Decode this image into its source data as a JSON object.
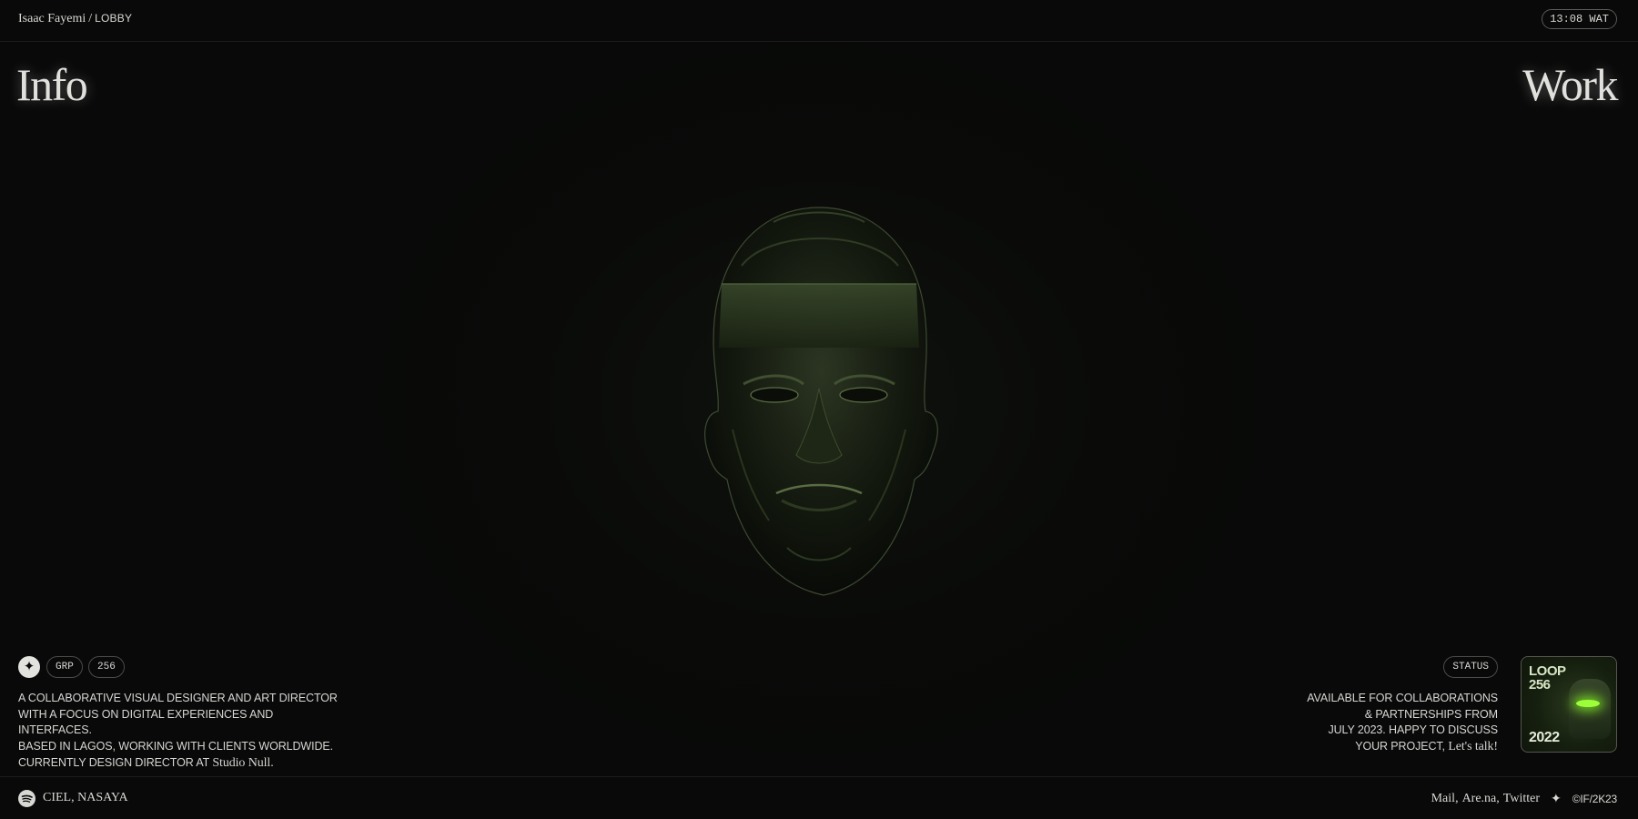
{
  "header": {
    "name": "Isaac Fayemi",
    "separator": "/",
    "section": "LOBBY",
    "clock": "13:08 WAT"
  },
  "nav": {
    "left": "Info",
    "right": "Work"
  },
  "hero": {
    "icon": "sculpted-head-artwork",
    "tint": "#2f3a24"
  },
  "left_panel": {
    "badge_icon": "sparkle-icon",
    "pills": [
      "GRP",
      "256"
    ],
    "bio_lines": [
      "A COLLABORATIVE VISUAL DESIGNER AND ART DIRECTOR",
      "WITH A FOCUS ON DIGITAL EXPERIENCES AND INTERFACES.",
      "BASED IN LAGOS, WORKING WITH CLIENTS WORLDWIDE.",
      "CURRENTLY DESIGN DIRECTOR AT"
    ],
    "studio": "Studio Null."
  },
  "right_panel": {
    "status_label": "STATUS",
    "status_lines": [
      "AVAILABLE FOR COLLABORATIONS",
      "& PARTNERSHIPS FROM",
      "JULY 2023. HAPPY TO DISCUSS",
      "YOUR PROJECT,"
    ],
    "cta": "Let's talk!",
    "card": {
      "title_line1": "LOOP",
      "title_line2": "256",
      "year": "2022",
      "accent": "#9cff3a"
    }
  },
  "footer": {
    "music_icon": "spotify-icon",
    "now_playing": "CIEL, NASAYA",
    "links": [
      "Mail",
      "Are.na",
      "Twitter"
    ],
    "sparkle": "✦",
    "copyright": "©IF/2K23"
  }
}
